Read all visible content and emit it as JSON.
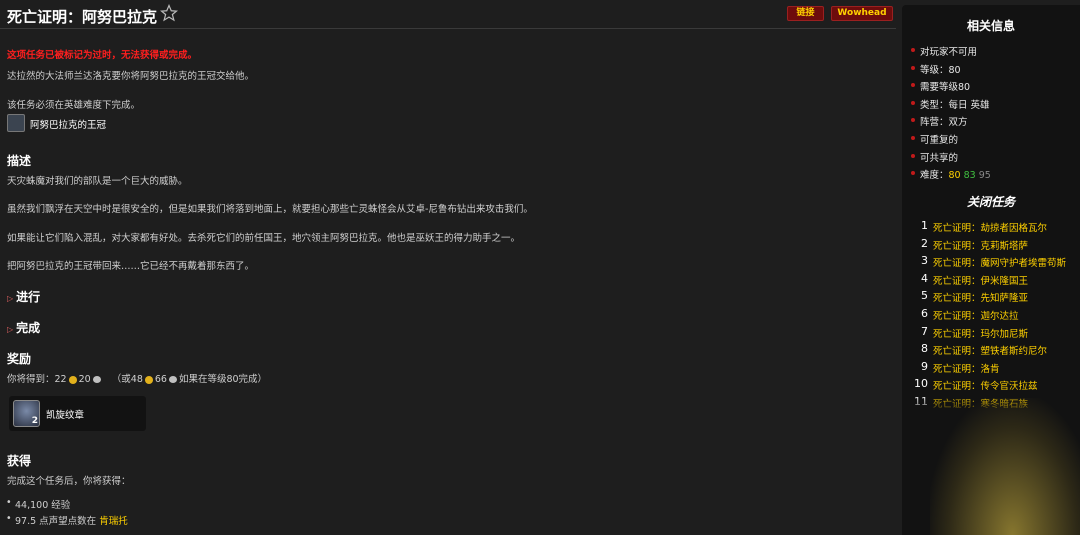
{
  "header": {
    "title": "死亡证明：阿努巴拉克",
    "link_button": "链接",
    "wowhead_button": "Wowhead"
  },
  "notice": {
    "deprecated": "这项任务已被标记为过时，无法获得或完成。",
    "start_text": "达拉然的大法师兰达洛克要你将阿努巴拉克的王冠交给他。",
    "heroic_text": "该任务必须在英雄难度下完成。",
    "item_name": "阿努巴拉克的王冠"
  },
  "description": {
    "heading": "描述",
    "p1": "天灾蛛魔对我们的部队是一个巨大的威胁。",
    "p2": "虽然我们飘浮在天空中时是很安全的，但是如果我们将落到地面上，就要担心那些亡灵蛛怪会从艾卓-尼鲁布钻出来攻击我们。",
    "p3": "如果能让它们陷入混乱，对大家都有好处。去杀死它们的前任国王，地穴领主阿努巴拉克。他也是巫妖王的得力助手之一。",
    "p4": "把阿努巴拉克的王冠带回来……它已经不再戴着那东西了。"
  },
  "sections": {
    "progress": "进行",
    "completion": "完成"
  },
  "rewards": {
    "heading": "奖励",
    "you_get": "你将得到：",
    "gold": "22",
    "silver": "20",
    "alt_open": "（或",
    "alt_gold": "48",
    "alt_silver": "66",
    "alt_tail": "如果在等级80完成）",
    "item_name": "凯旋纹章",
    "item_count": "2"
  },
  "gains": {
    "heading": "获得",
    "intro": "完成这个任务后，你将获得：",
    "xp": "44,100 经验",
    "rep_prefix": "97.5 点声望点数在",
    "rep_faction": "肯瑞托"
  },
  "sidebar": {
    "title": "相关信息",
    "info": [
      "对玩家不可用",
      "等级：80",
      "需要等级80",
      "类型：每日 英雄",
      "阵营：双方",
      "可重复的",
      "可共享的"
    ],
    "difficulty_label": "难度：",
    "difficulty": [
      "80",
      "83",
      "95"
    ],
    "chain_title": "关闭任务",
    "chain": [
      {
        "num": "1",
        "name": "死亡证明：劫掠者因格瓦尔"
      },
      {
        "num": "2",
        "name": "死亡证明：克莉斯塔萨"
      },
      {
        "num": "3",
        "name": "死亡证明：魔网守护者埃雷苟斯"
      },
      {
        "num": "4",
        "name": "死亡证明：伊米隆国王"
      },
      {
        "num": "5",
        "name": "死亡证明：先知萨隆亚"
      },
      {
        "num": "6",
        "name": "死亡证明：迦尔达拉"
      },
      {
        "num": "7",
        "name": "死亡证明：玛尔加尼斯"
      },
      {
        "num": "8",
        "name": "死亡证明：塑铁者斯约尼尔"
      },
      {
        "num": "9",
        "name": "死亡证明：洛肯"
      },
      {
        "num": "10",
        "name": "死亡证明：传令官沃拉兹"
      },
      {
        "num": "11",
        "name": "死亡证明：寒冬暗石族"
      }
    ]
  },
  "colors": {
    "background": "#1e1e1e",
    "accent_yellow": "#ffd100",
    "alert_red": "#ff1f1f",
    "button_red": "#6d0c0c"
  }
}
